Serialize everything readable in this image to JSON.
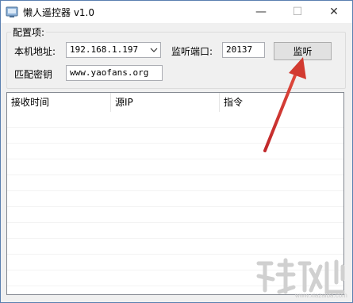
{
  "window": {
    "title": "懒人遥控器 v1.0",
    "minimize_symbol": "—",
    "maximize_symbol": "☐",
    "close_symbol": "✕"
  },
  "config": {
    "group_title": "配置项:",
    "local_address_label": "本机地址:",
    "local_address_value": "192.168.1.197",
    "listen_port_label": "监听端口:",
    "listen_port_value": "20137",
    "listen_button": "监听",
    "match_key_label": "匹配密钥",
    "match_key_value": "www.yaofans.org"
  },
  "list": {
    "columns": [
      "接收时间",
      "源IP",
      "指令"
    ],
    "rows": []
  },
  "watermark": {
    "text": "www.xiazaiba.com"
  },
  "colors": {
    "accent_arrow": "#c0282b"
  }
}
